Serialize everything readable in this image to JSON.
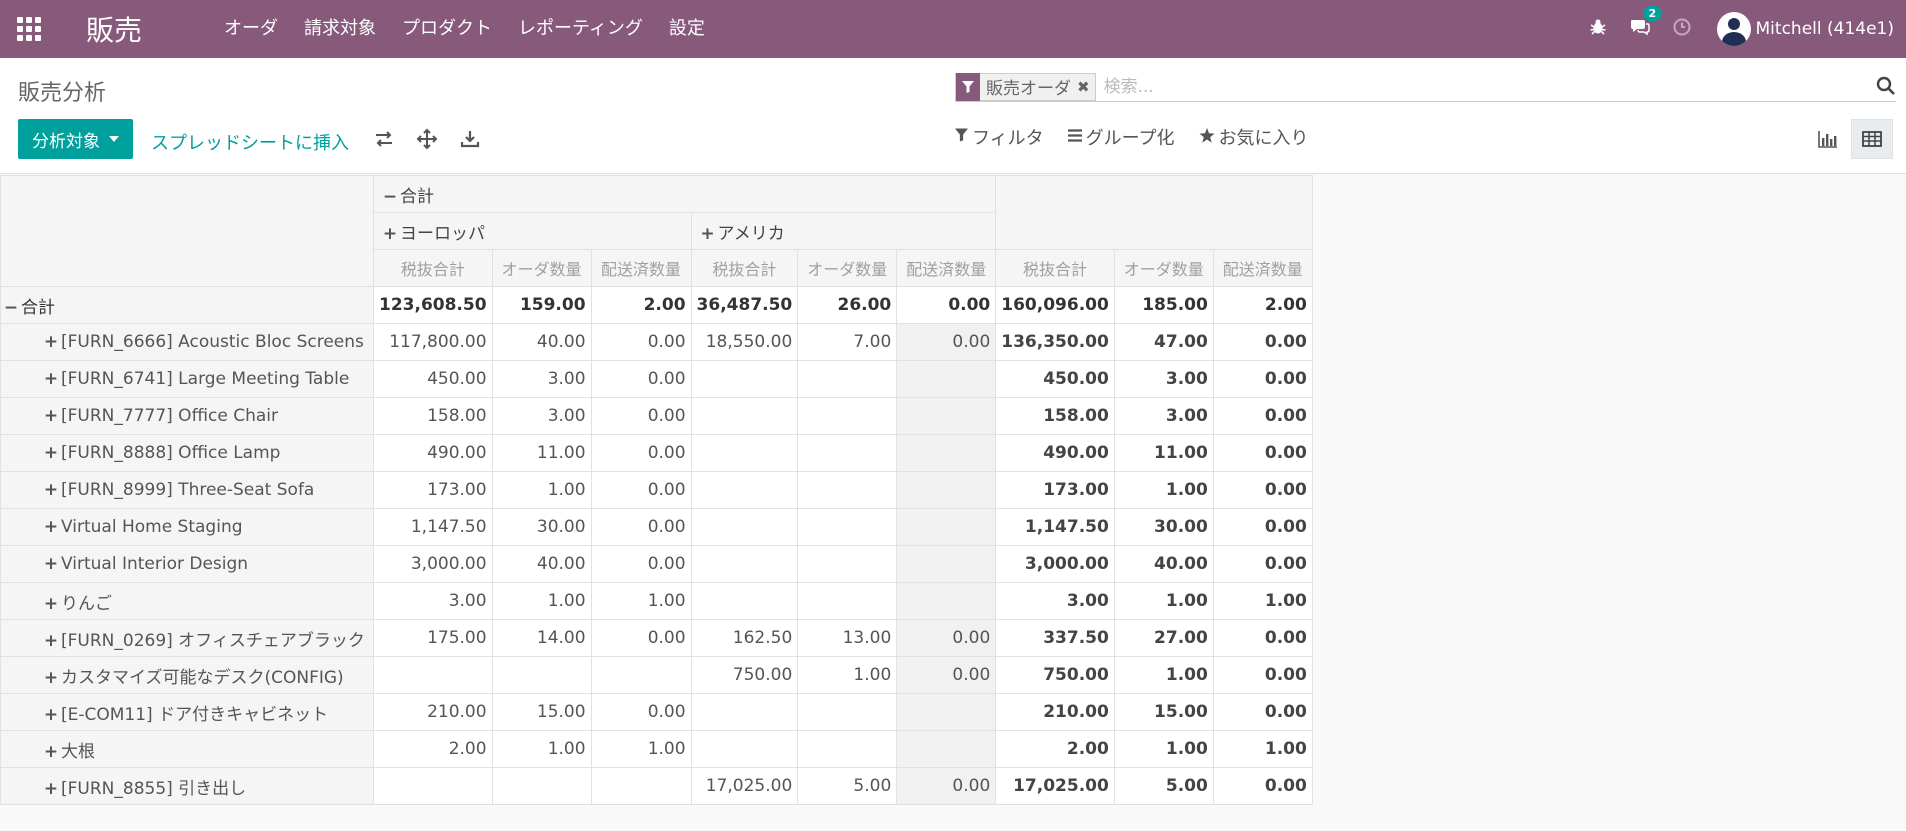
{
  "navbar": {
    "brand": "販売",
    "menu": [
      "オーダ",
      "請求対象",
      "プロダクト",
      "レポーティング",
      "設定"
    ],
    "messages_count": "2",
    "user_name": "Mitchell (414e1)"
  },
  "control": {
    "breadcrumb": "販売分析",
    "facet": "販売オーダ",
    "search_placeholder": "検索...",
    "measures_button": "分析対象",
    "insert_sheet_link": "スプレッドシートに挿入",
    "filter": "フィルタ",
    "group_by": "グループ化",
    "favorites": "お気に入り"
  },
  "pivot": {
    "col_total": "合計",
    "col_groups": [
      "ヨーロッパ",
      "アメリカ"
    ],
    "measures": [
      "税抜合計",
      "オーダ数量",
      "配送済数量"
    ],
    "row_total_label": "合計",
    "grand": [
      "123,608.50",
      "159.00",
      "2.00",
      "36,487.50",
      "26.00",
      "0.00",
      "160,096.00",
      "185.00",
      "2.00"
    ],
    "rows": [
      {
        "label": "[FURN_6666] Acoustic Bloc Screens",
        "cells": [
          "117,800.00",
          "40.00",
          "0.00",
          "18,550.00",
          "7.00",
          "0.00",
          "136,350.00",
          "47.00",
          "0.00"
        ]
      },
      {
        "label": "[FURN_6741] Large Meeting Table",
        "cells": [
          "450.00",
          "3.00",
          "0.00",
          "",
          "",
          "",
          "450.00",
          "3.00",
          "0.00"
        ]
      },
      {
        "label": "[FURN_7777] Office Chair",
        "cells": [
          "158.00",
          "3.00",
          "0.00",
          "",
          "",
          "",
          "158.00",
          "3.00",
          "0.00"
        ]
      },
      {
        "label": "[FURN_8888] Office Lamp",
        "cells": [
          "490.00",
          "11.00",
          "0.00",
          "",
          "",
          "",
          "490.00",
          "11.00",
          "0.00"
        ]
      },
      {
        "label": "[FURN_8999] Three-Seat Sofa",
        "cells": [
          "173.00",
          "1.00",
          "0.00",
          "",
          "",
          "",
          "173.00",
          "1.00",
          "0.00"
        ]
      },
      {
        "label": "Virtual Home Staging",
        "cells": [
          "1,147.50",
          "30.00",
          "0.00",
          "",
          "",
          "",
          "1,147.50",
          "30.00",
          "0.00"
        ]
      },
      {
        "label": "Virtual Interior Design",
        "cells": [
          "3,000.00",
          "40.00",
          "0.00",
          "",
          "",
          "",
          "3,000.00",
          "40.00",
          "0.00"
        ]
      },
      {
        "label": "りんご",
        "cells": [
          "3.00",
          "1.00",
          "1.00",
          "",
          "",
          "",
          "3.00",
          "1.00",
          "1.00"
        ]
      },
      {
        "label": "[FURN_0269] オフィスチェアブラック",
        "cells": [
          "175.00",
          "14.00",
          "0.00",
          "162.50",
          "13.00",
          "0.00",
          "337.50",
          "27.00",
          "0.00"
        ]
      },
      {
        "label": "カスタマイズ可能なデスク(CONFIG)",
        "cells": [
          "",
          "",
          "",
          "750.00",
          "1.00",
          "0.00",
          "750.00",
          "1.00",
          "0.00"
        ]
      },
      {
        "label": "[E-COM11] ドア付きキャビネット",
        "cells": [
          "210.00",
          "15.00",
          "0.00",
          "",
          "",
          "",
          "210.00",
          "15.00",
          "0.00"
        ]
      },
      {
        "label": "大根",
        "cells": [
          "2.00",
          "1.00",
          "1.00",
          "",
          "",
          "",
          "2.00",
          "1.00",
          "1.00"
        ]
      },
      {
        "label": "[FURN_8855] 引き出し",
        "cells": [
          "",
          "",
          "",
          "17,025.00",
          "5.00",
          "0.00",
          "17,025.00",
          "5.00",
          "0.00"
        ]
      }
    ]
  }
}
